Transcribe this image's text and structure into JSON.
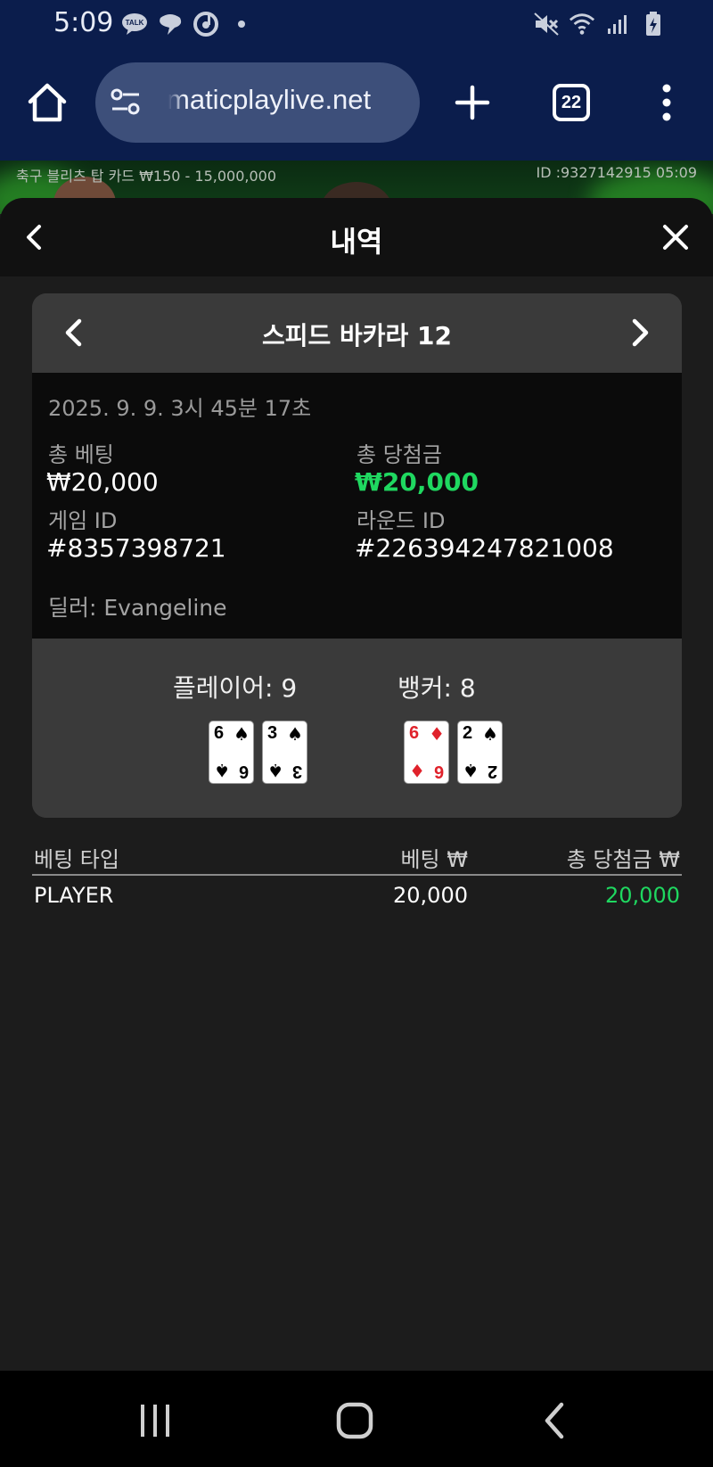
{
  "status_bar": {
    "time": "5:09",
    "talk_label": "TALK"
  },
  "browser": {
    "url": "maticplaylive.net",
    "tab_count": "22"
  },
  "game_strip": {
    "left_text": "축구 블리츠 탑 카드 ₩150 - 15,000,000",
    "right_text": "ID :9327142915 05:09"
  },
  "header": {
    "title": "내역"
  },
  "game": {
    "name": "스피드 바카라 12",
    "date": "2025. 9. 9. 3시 45분 17초",
    "total_bet_label": "총 베팅",
    "total_bet_value": "₩20,000",
    "total_win_label": "총 당첨금",
    "total_win_value": "₩20,000",
    "game_id_label": "게임 ID",
    "game_id_value": "#8357398721",
    "round_id_label": "라운드 ID",
    "round_id_value": "#226394247821008",
    "dealer": "딜러: Evangeline"
  },
  "result": {
    "player_score": "플레이어: 9",
    "banker_score": "뱅커: 8",
    "player_cards": [
      {
        "rank": "6",
        "suit": "♠"
      },
      {
        "rank": "3",
        "suit": "♠"
      }
    ],
    "banker_cards": [
      {
        "rank": "6",
        "suit": "♦"
      },
      {
        "rank": "2",
        "suit": "♠"
      }
    ]
  },
  "bets": {
    "headers": [
      "베팅 타입",
      "베팅 ₩",
      "총 당첨금 ₩"
    ],
    "rows": [
      {
        "type": "PLAYER",
        "bet": "20,000",
        "win": "20,000"
      }
    ]
  },
  "colors": {
    "win_green": "#1fd860",
    "chrome_blue": "#0b1d4c",
    "card_red": "#e0222b"
  }
}
